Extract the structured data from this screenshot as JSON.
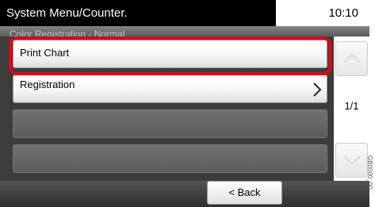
{
  "status_bar": {
    "title": "System Menu/Counter.",
    "time": "10:10"
  },
  "screen_title": "Color Registration - Normal",
  "menu_items": [
    {
      "label": "Print Chart",
      "selected": true,
      "has_submenu": false
    },
    {
      "label": "Registration",
      "selected": false,
      "has_submenu": true
    }
  ],
  "page_indicator": "1/1",
  "footer": {
    "back_label": "< Back"
  },
  "colors": {
    "highlight": "#e30613",
    "screen_bg": "#3c3c3c"
  },
  "icons": {
    "scroll_up": "chevron-up-icon",
    "scroll_down": "chevron-down-icon",
    "submenu": "chevron-right-icon"
  }
}
